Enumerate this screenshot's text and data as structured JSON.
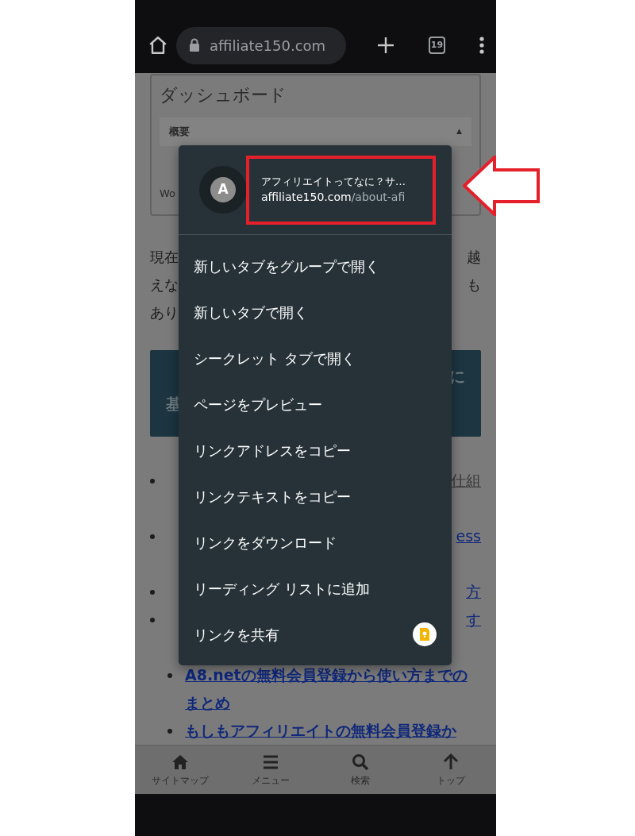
{
  "browser_toolbar": {
    "url": "affiliate150.com",
    "tab_count": "19"
  },
  "page": {
    "dashboard": {
      "title": "ダッシュボード",
      "section_title": "概要",
      "section_toggle": "▲",
      "fragment": "Wo"
    },
    "paragraph_lines": [
      {
        "left": "現在",
        "right": "越"
      },
      {
        "left": "えな",
        "right": "も"
      },
      {
        "left": "あり"
      }
    ],
    "heading_lines": [
      {
        "right": "に"
      },
      {
        "left": "基"
      }
    ],
    "links": [
      {
        "lines": [
          {
            "right": "仕組"
          }
        ],
        "wrapped": true,
        "visited": true
      },
      {
        "lines": [
          {
            "right": "ess"
          }
        ],
        "wrapped": true,
        "visited": false
      },
      {
        "lines": [
          {
            "right": "方"
          }
        ],
        "wrapped": false,
        "visited": false
      },
      {
        "lines": [
          {
            "right": "す"
          }
        ],
        "wrapped": true,
        "visited": false,
        "children": [
          {
            "lines": [
              {
                "left": "A8.netの無料会員登録から使い方までの"
              },
              {
                "left": "まとめ"
              }
            ],
            "wrapped": false,
            "visited": false
          },
          {
            "lines": [
              {
                "left": "もしもアフィリエイトの無料会員登録か"
              }
            ],
            "wrapped": false,
            "visited": false
          }
        ]
      }
    ]
  },
  "context_menu": {
    "link_title": "アフィリエイトってなに？サ…",
    "link_host": "affiliate150.com",
    "link_path": "/about-afi",
    "avatar_letter": "A",
    "highlighted": true,
    "items": [
      {
        "label": "新しいタブをグループで開く",
        "kind": "plain"
      },
      {
        "label": "新しいタブで開く",
        "kind": "plain"
      },
      {
        "label": "シークレット タブで開く",
        "kind": "plain"
      },
      {
        "label": "ページをプレビュー",
        "kind": "plain"
      },
      {
        "label": "リンクアドレスをコピー",
        "kind": "plain"
      },
      {
        "label": "リンクテキストをコピー",
        "kind": "plain"
      },
      {
        "label": "リンクをダウンロード",
        "kind": "plain"
      },
      {
        "label": "リーディング リストに追加",
        "kind": "plain"
      },
      {
        "label": "リンクを共有",
        "kind": "share"
      }
    ]
  },
  "bottom_nav": [
    {
      "label": "サイトマップ"
    },
    {
      "label": "メニュー"
    },
    {
      "label": "検索"
    },
    {
      "label": "トップ"
    }
  ]
}
